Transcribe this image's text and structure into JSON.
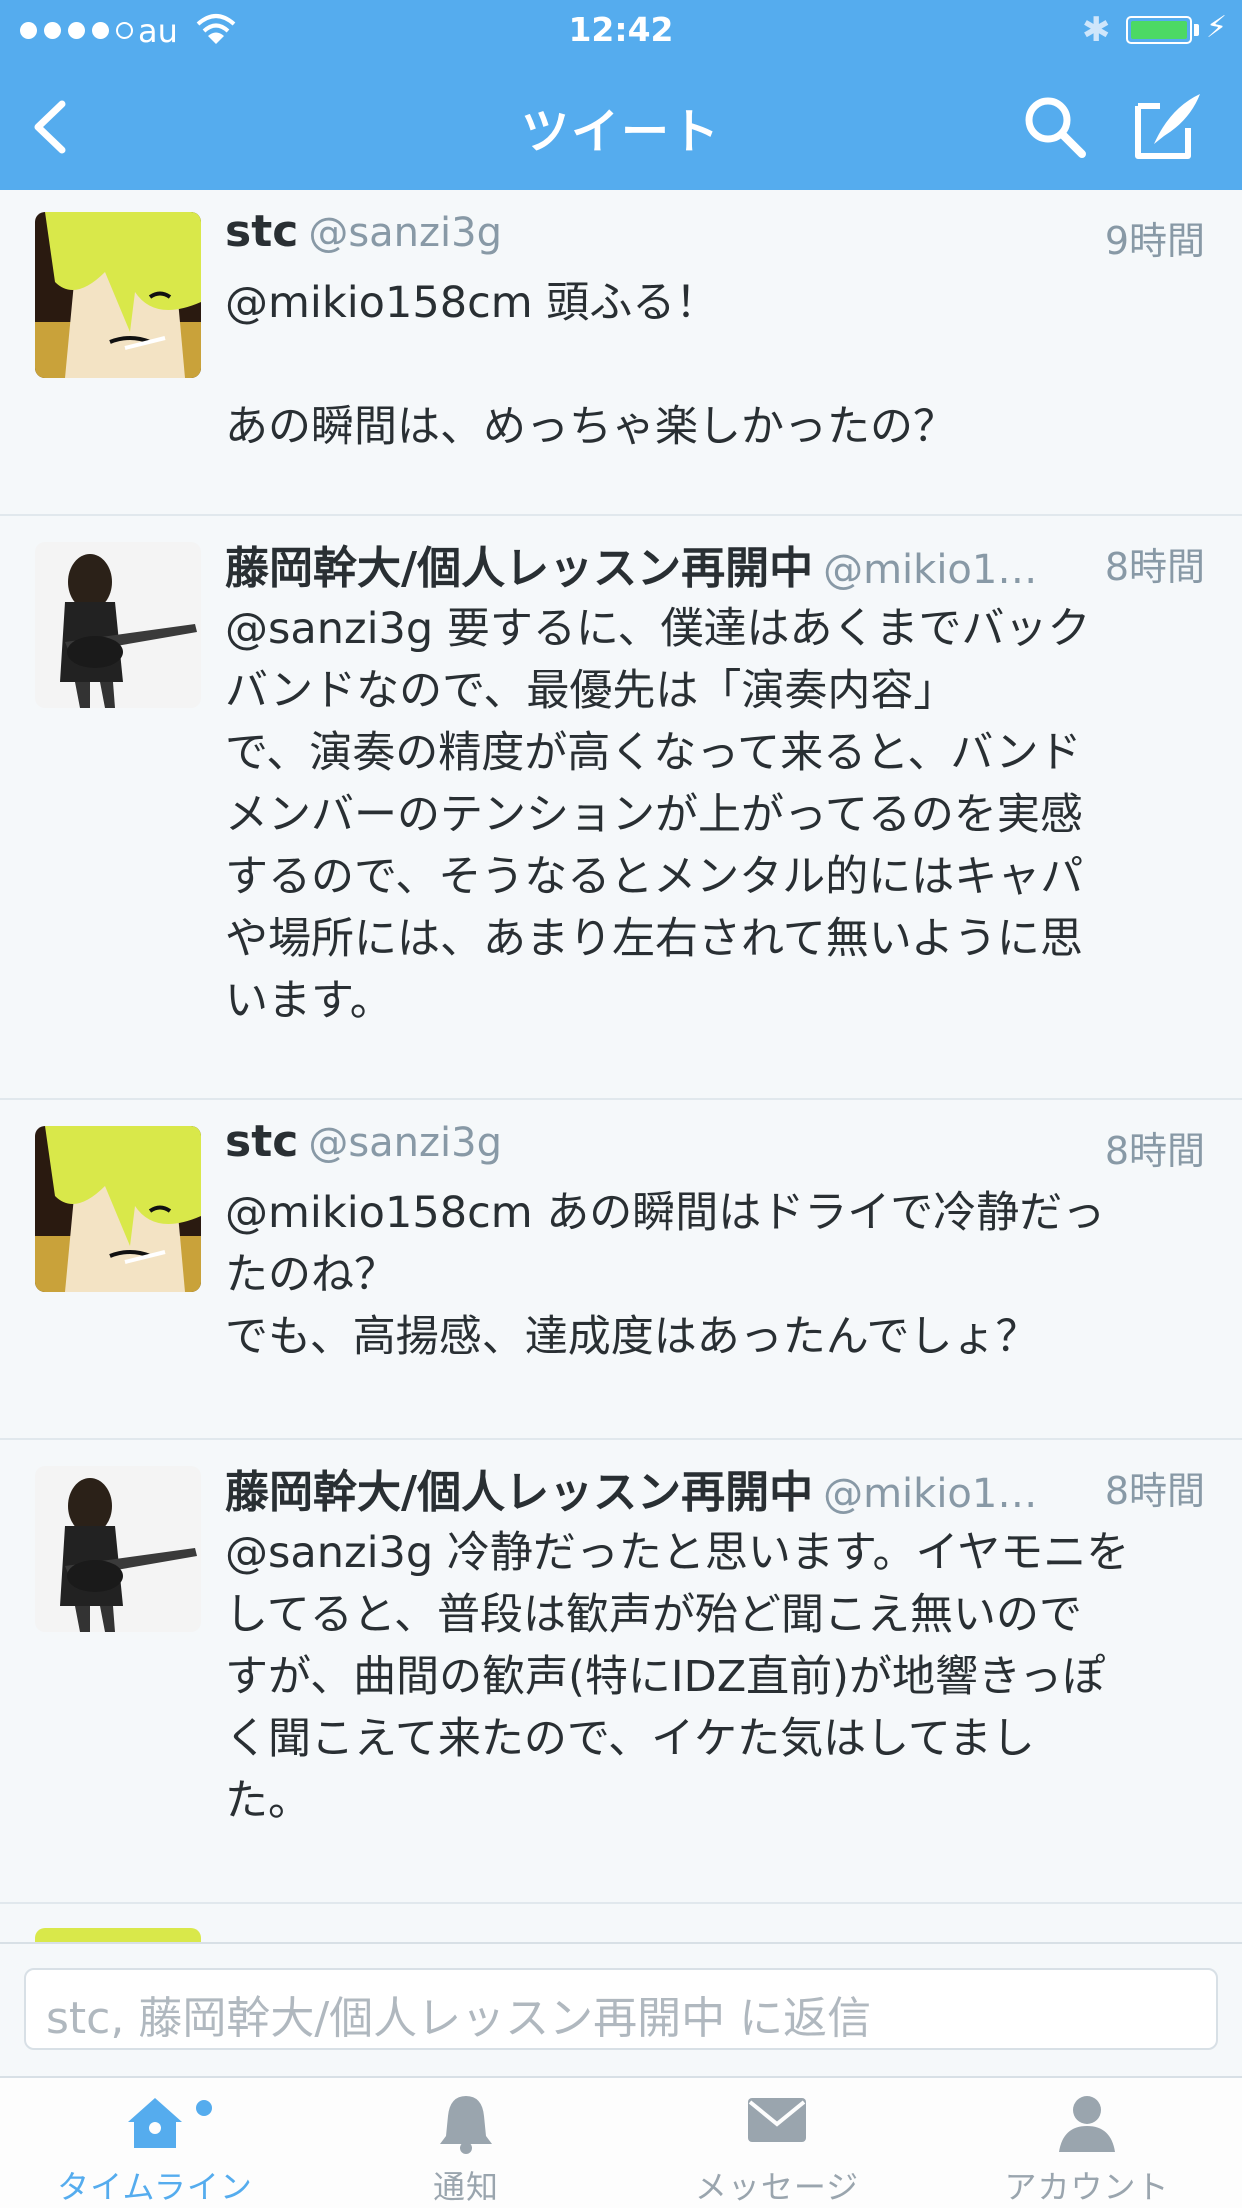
{
  "status_bar": {
    "carrier": "au",
    "time": "12:42",
    "battery_level": 1.0
  },
  "nav": {
    "title": "ツイート",
    "back_icon": "chevron-left-icon",
    "search_icon": "search-icon",
    "compose_icon": "compose-icon"
  },
  "tweets": [
    {
      "name": "stc",
      "handle": "@sanzi3g",
      "time": "9時間",
      "text": "@mikio158cm 頭ふる！\n\nあの瞬間は、めっちゃ楽しかったの？"
    },
    {
      "name": "藤岡幹大/個人レッスン再開中",
      "handle": "@mikio1…",
      "time": "8時間",
      "text": "@sanzi3g 要するに、僕達はあくまでバック\nバンドなので、最優先は「演奏内容」\nで、演奏の精度が高くなって来ると、バンド\nメンバーのテンションが上がってるのを実感\nするので、そうなるとメンタル的にはキャパ\nや場所には、あまり左右されて無いように思\nいます。"
    },
    {
      "name": "stc",
      "handle": "@sanzi3g",
      "time": "8時間",
      "text": "@mikio158cm あの瞬間はドライで冷静だっ\nたのね？\nでも、高揚感、達成度はあったんでしょ？"
    },
    {
      "name": "藤岡幹大/個人レッスン再開中",
      "handle": "@mikio1…",
      "time": "8時間",
      "text": "@sanzi3g 冷静だったと思います。イヤモニを\nしてると、普段は歓声が殆ど聞こえ無いので\nすが、曲間の歓声(特にIDZ直前)が地響きっぽ\nく聞こえて来たので、イケた気はしてまし\nた。"
    }
  ],
  "reply": {
    "placeholder": "stc, 藤岡幹大/個人レッスン再開中 に返信"
  },
  "tabs": [
    {
      "label": "タイムライン",
      "icon": "home-icon",
      "active": true
    },
    {
      "label": "通知",
      "icon": "bell-icon"
    },
    {
      "label": "メッセージ",
      "icon": "envelope-icon"
    },
    {
      "label": "アカウント",
      "icon": "person-icon"
    }
  ],
  "colors": {
    "brand": "#55acee",
    "background": "#f5f8fa",
    "separator": "#e1e8ed"
  }
}
